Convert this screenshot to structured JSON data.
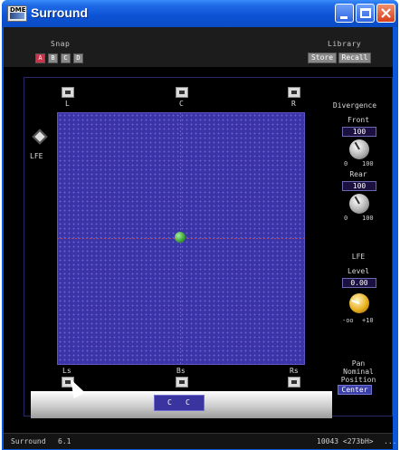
{
  "window": {
    "title": "Surround",
    "app_icon_text": "DME"
  },
  "snap": {
    "label": "Snap",
    "buttons": [
      "A",
      "B",
      "C",
      "D"
    ],
    "active": "A"
  },
  "library": {
    "label": "Library",
    "store_label": "Store",
    "recall_label": "Recall"
  },
  "speakers": {
    "front_left": "L",
    "center": "C",
    "front_right": "R",
    "lfe": "LFE",
    "surround_left": "Ls",
    "back_surround": "Bs",
    "surround_right": "Rs"
  },
  "bottom_selector": {
    "left": "C",
    "right": "C"
  },
  "divergence": {
    "title": "Divergence",
    "front_label": "Front",
    "front_value": "100",
    "front_min": "0",
    "front_max": "100",
    "rear_label": "Rear",
    "rear_value": "100",
    "rear_min": "0",
    "rear_max": "100"
  },
  "lfe_section": {
    "title": "LFE",
    "level_label": "Level",
    "level_value": "0.00",
    "min": "-oo",
    "max": "+10"
  },
  "pan": {
    "line1": "Pan",
    "line2": "Nominal",
    "line3": "Position",
    "center_label": "Center"
  },
  "status": {
    "name": "Surround",
    "mode": "6.1",
    "memory": "10043 <273bH>",
    "more": "..."
  },
  "colors": {
    "title_blue": "#0b52d4",
    "field": "#3b33a8",
    "close_red": "#d8401c",
    "snap_active": "#c8344a"
  },
  "icons": {
    "minimize": "minimize-icon",
    "maximize": "maximize-icon",
    "close": "close-icon",
    "speaker": "speaker-icon",
    "lfe": "lfe-diamond-icon",
    "cursor": "mouse-cursor-icon"
  }
}
